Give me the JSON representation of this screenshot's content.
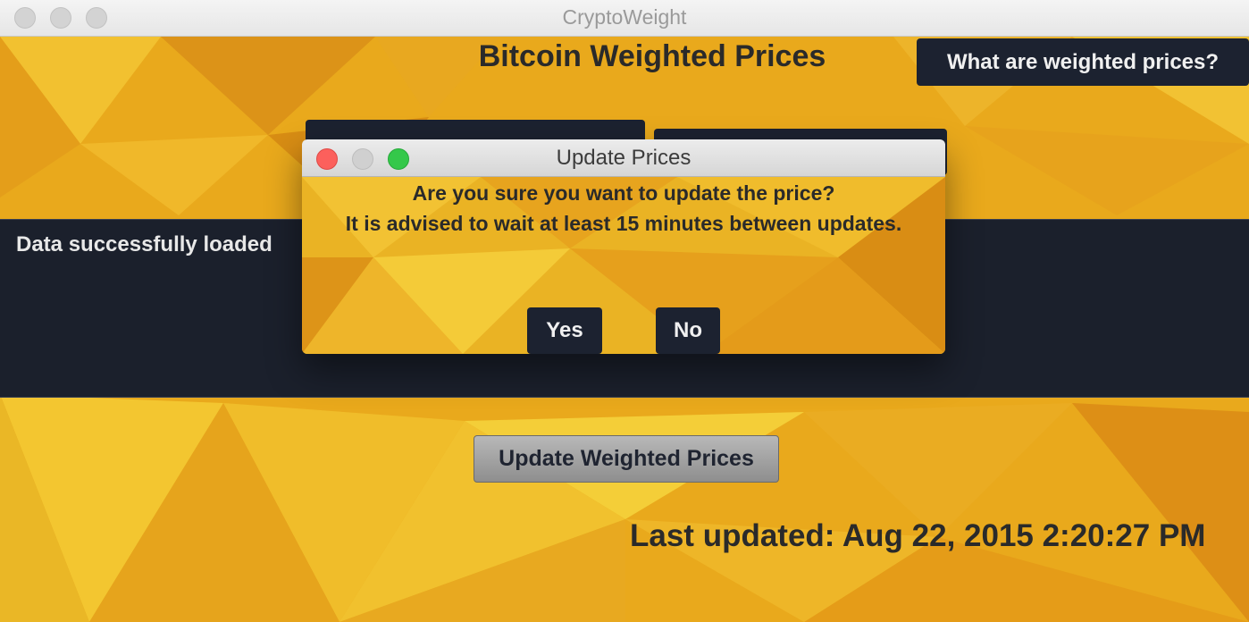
{
  "window": {
    "title": "CryptoWeight"
  },
  "header": {
    "title": "Bitcoin Weighted Prices",
    "help_button": "What are weighted prices?"
  },
  "console": {
    "message": "Data successfully loaded"
  },
  "actions": {
    "update_button": "Update Weighted Prices"
  },
  "status": {
    "last_updated": "Last updated: Aug 22, 2015 2:20:27 PM"
  },
  "dialog": {
    "title": "Update Prices",
    "line1": "Are you sure you want to update the price?",
    "line2": "It is advised to wait at least 15 minutes between updates.",
    "yes": "Yes",
    "no": "No"
  },
  "colors": {
    "background": "#e8a41a",
    "dark_panel": "#1b202c",
    "button_dark": "#1c2230",
    "close": "#fc605c",
    "maximize": "#34c84a"
  }
}
